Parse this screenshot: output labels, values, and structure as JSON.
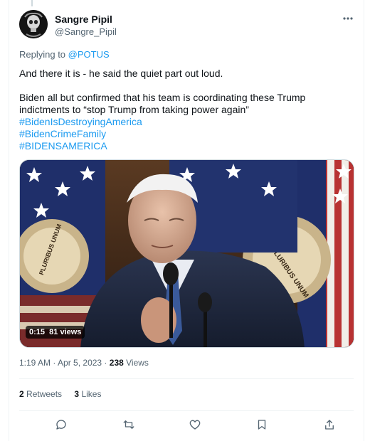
{
  "author": {
    "display_name": "Sangre Pipil",
    "handle": "@Sangre_Pipil"
  },
  "reply": {
    "prefix": "Replying to",
    "mention": "@POTUS"
  },
  "tweet": {
    "line1": "And there it is - he said the quiet part out loud.",
    "line2": "Biden all but confirmed that his team is coordinating these Trump indictments to “stop Trump from taking power again”",
    "hashtags": [
      "#BidenIsDestroyingAmerica",
      "#BidenCrimeFamily",
      "#BIDENSAMERICA"
    ]
  },
  "video": {
    "duration": "0:15",
    "views": "81 views",
    "seal_text": "PLURIBUS UNUM"
  },
  "meta": {
    "time": "1:19 AM",
    "date": "Apr 5, 2023",
    "views_count": "238",
    "views_label": "Views"
  },
  "stats": {
    "retweets_count": "2",
    "retweets_label": "Retweets",
    "likes_count": "3",
    "likes_label": "Likes"
  },
  "icons": {
    "more": "more-horizontal-icon",
    "reply": "reply-icon",
    "retweet": "retweet-icon",
    "like": "heart-icon",
    "bookmark": "bookmark-icon",
    "share": "share-icon"
  },
  "colors": {
    "link": "#1d9bf0",
    "text": "#0f1419",
    "secondary": "#536471"
  }
}
